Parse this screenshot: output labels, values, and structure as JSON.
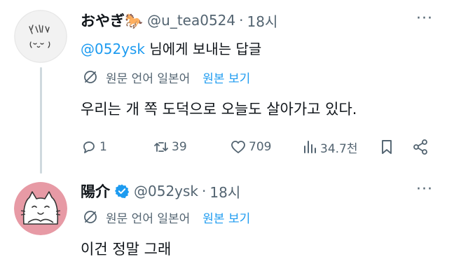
{
  "tweet1": {
    "name": "おやぎ🐎",
    "handle": "@u_tea0524",
    "dot": "·",
    "time": "18시",
    "more": "···",
    "replying_mention": "@052ysk",
    "replying_suffix": " 님에게 보내는 답글",
    "translate_text": "원문 언어 일본어",
    "translate_link": "원본 보기",
    "body": "우리는 개 쪽 도덕으로 오늘도 살아가고 있다.",
    "actions": {
      "replies": "1",
      "retweets": "39",
      "likes": "709",
      "views": "34.7천"
    },
    "avatar_text": "ﾊﾞﾚﾊﾞﾚ\n(^o^)"
  },
  "tweet2": {
    "name": "陽介",
    "verified_icon": "verified-badge-icon",
    "handle": "@052ysk",
    "dot": "·",
    "time": "18시",
    "more": "···",
    "translate_text": "원문 언어 일본어",
    "translate_link": "원본 보기",
    "body": "이건 정말 그래"
  },
  "colors": {
    "accent": "#1d9bf0",
    "secondary_text": "#536471",
    "primary_text": "#0f1419",
    "thread_line": "#cfd9de",
    "avatar2_bg": "#e79aa5"
  }
}
